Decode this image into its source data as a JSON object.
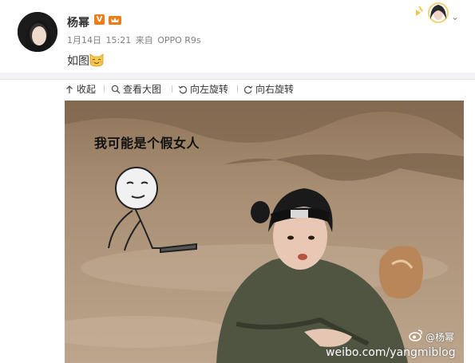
{
  "post": {
    "username": "杨幂",
    "verified_badge": "V",
    "date": "1月14日",
    "time": "15:21",
    "via": "来自",
    "device": "OPPO R9s",
    "text": "如图",
    "emoji": "cat-smile-emoji"
  },
  "toolbar": {
    "collapse": "收起",
    "view_large": "查看大图",
    "rotate_left": "向左旋转",
    "rotate_right": "向右旋转"
  },
  "image": {
    "meme_caption": "我可能是个假女人",
    "headband_text": "英",
    "watermark_handle": "@杨幂",
    "watermark_url": "weibo.com/yangmiblog"
  },
  "colors": {
    "accent_orange": "#f07c16",
    "divider": "#f2f2f5",
    "mud": "#a48a6e"
  }
}
